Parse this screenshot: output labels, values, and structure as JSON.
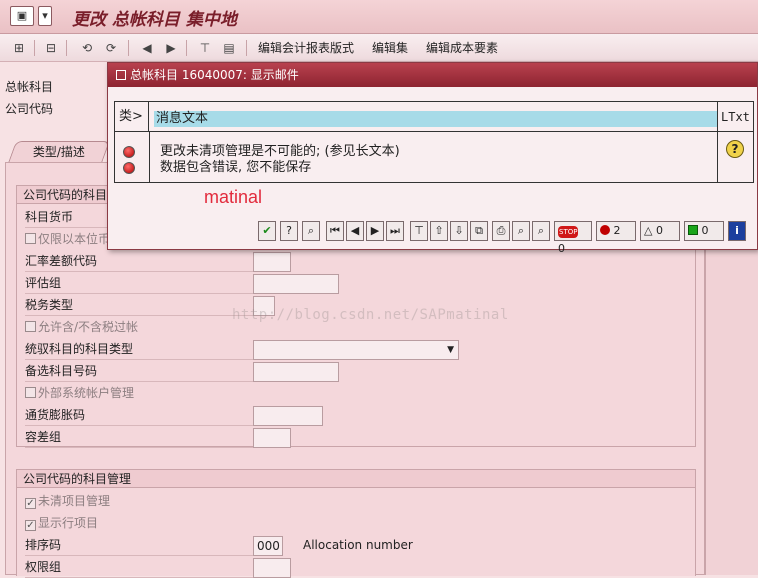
{
  "titlebar": {
    "title": "更改 总帐科目 集中地",
    "icon1": "▣",
    "icon2": "▾"
  },
  "toolbar": {
    "icons": [
      "⊞",
      "⊟",
      "⟲",
      "⟳",
      "◀",
      "▶",
      "⊤",
      "▤"
    ],
    "items": [
      "编辑会计报表版式",
      "编辑集",
      "编辑成本要素"
    ]
  },
  "header_fields": {
    "gl_account_label": "总帐科目",
    "company_code_label": "公司代码"
  },
  "tabs": {
    "type_desc": "类型/描述"
  },
  "group1": {
    "title": "公司代码的科目控制",
    "account_currency": "科目货币",
    "only_local_currency": "仅限以本位币余额",
    "exchange_rate_key": "汇率差额代码",
    "valuation_group": "评估组",
    "tax_category": "税务类型",
    "posting_without_tax": "允许含/不含税过帐",
    "recon_account_type": "统驭科目的科目类型",
    "alternative_account": "备选科目号码",
    "external_mgmt": "外部系统帐户管理",
    "inflation_key": "通货膨胀码",
    "tolerance_group": "容差组"
  },
  "group2": {
    "title": "公司代码的科目管理",
    "open_item_mgmt": "未清项目管理",
    "line_item_display": "显示行项目",
    "sort_key_label": "排序码",
    "sort_key_value": "000",
    "sort_key_desc": "Allocation number",
    "authorization_group": "权限组"
  },
  "watermark": "http://blog.csdn.net/SAPmatinal",
  "popup": {
    "title": "总帐科目 16040007: 显示邮件",
    "col_type": "类>",
    "col_message": "消息文本",
    "col_ltxt": "LTxt",
    "messages": [
      "更改未清项管理是不可能的; (参见长文本)",
      "数据包含错误, 您不能保存"
    ],
    "ltxt_icon": "?",
    "signature": "matinal",
    "toolbar": {
      "stop_count": "0",
      "error_count": "2",
      "warning_count": "0",
      "success_count": "0",
      "info_icon": "i",
      "stop_label": "STOP"
    }
  }
}
